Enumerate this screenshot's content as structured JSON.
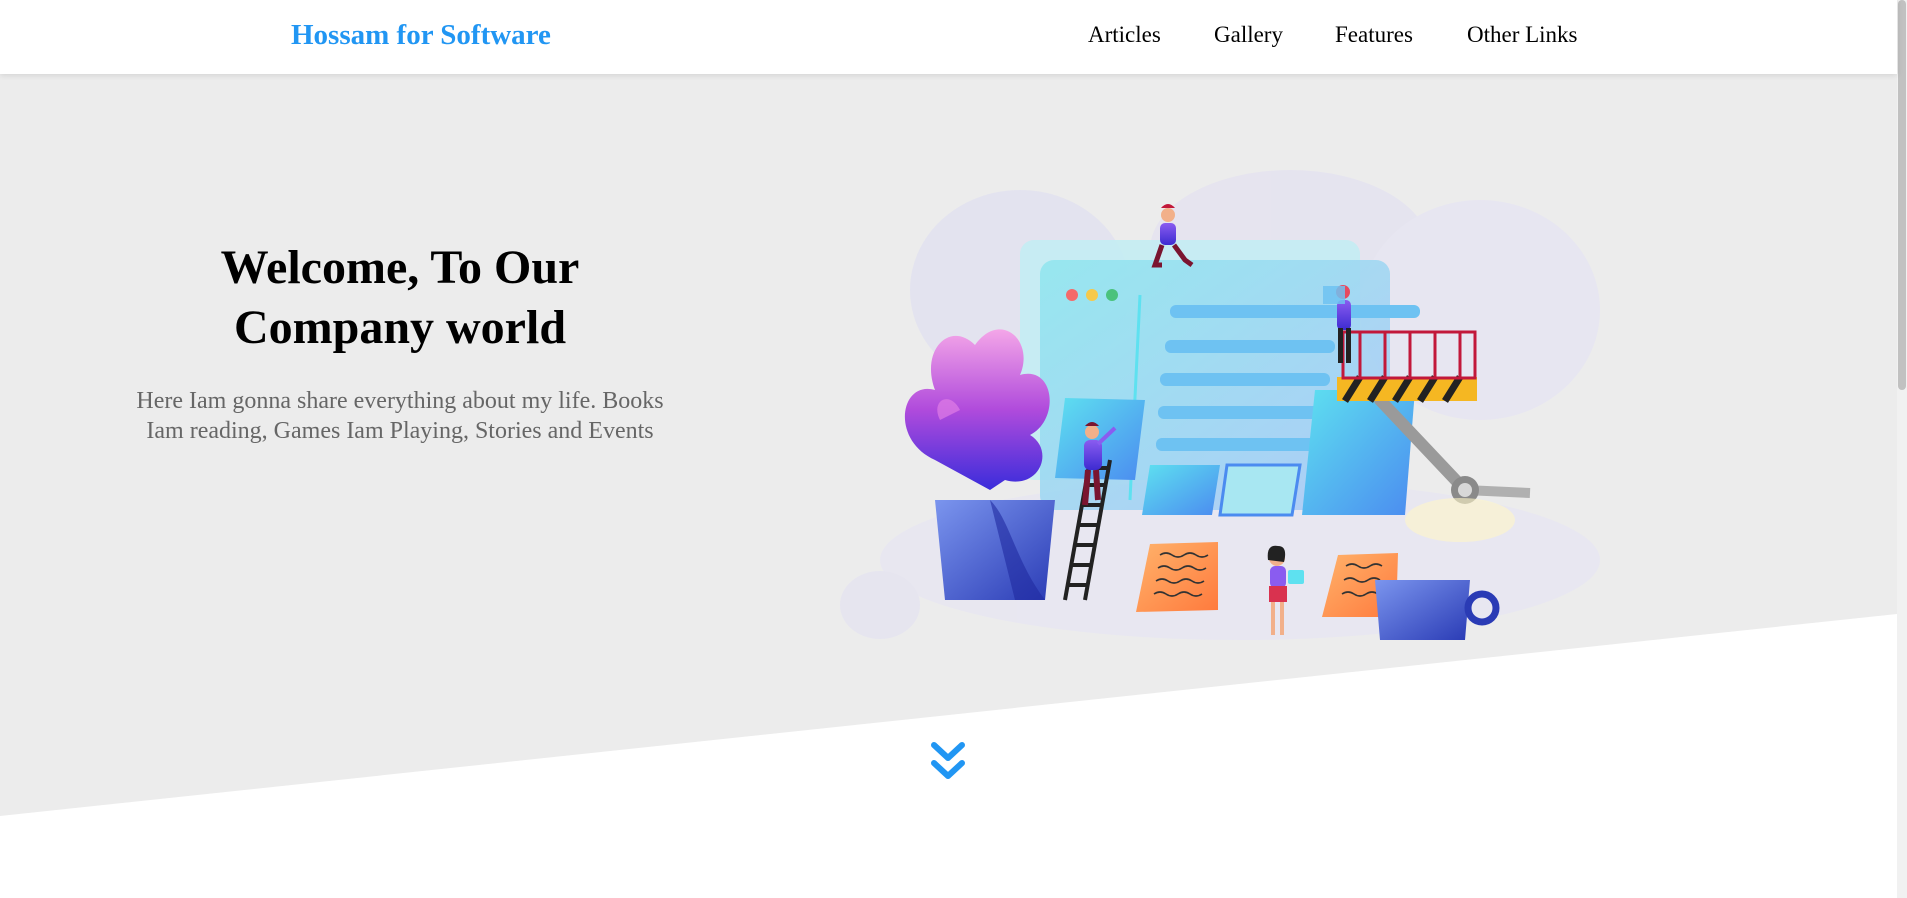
{
  "header": {
    "logo": "Hossam for Software",
    "nav": [
      "Articles",
      "Gallery",
      "Features",
      "Other Links"
    ]
  },
  "hero": {
    "title_line1": "Welcome, To Our",
    "title_line2": "Company world",
    "description": "Here Iam gonna share everything about my life. Books Iam reading, Games Iam Playing, Stories and Events"
  },
  "icons": {
    "scroll_down": "double-chevron-down-icon"
  },
  "colors": {
    "brand": "#2196f3",
    "hero_background": "#ececec",
    "text_muted": "#666666"
  }
}
